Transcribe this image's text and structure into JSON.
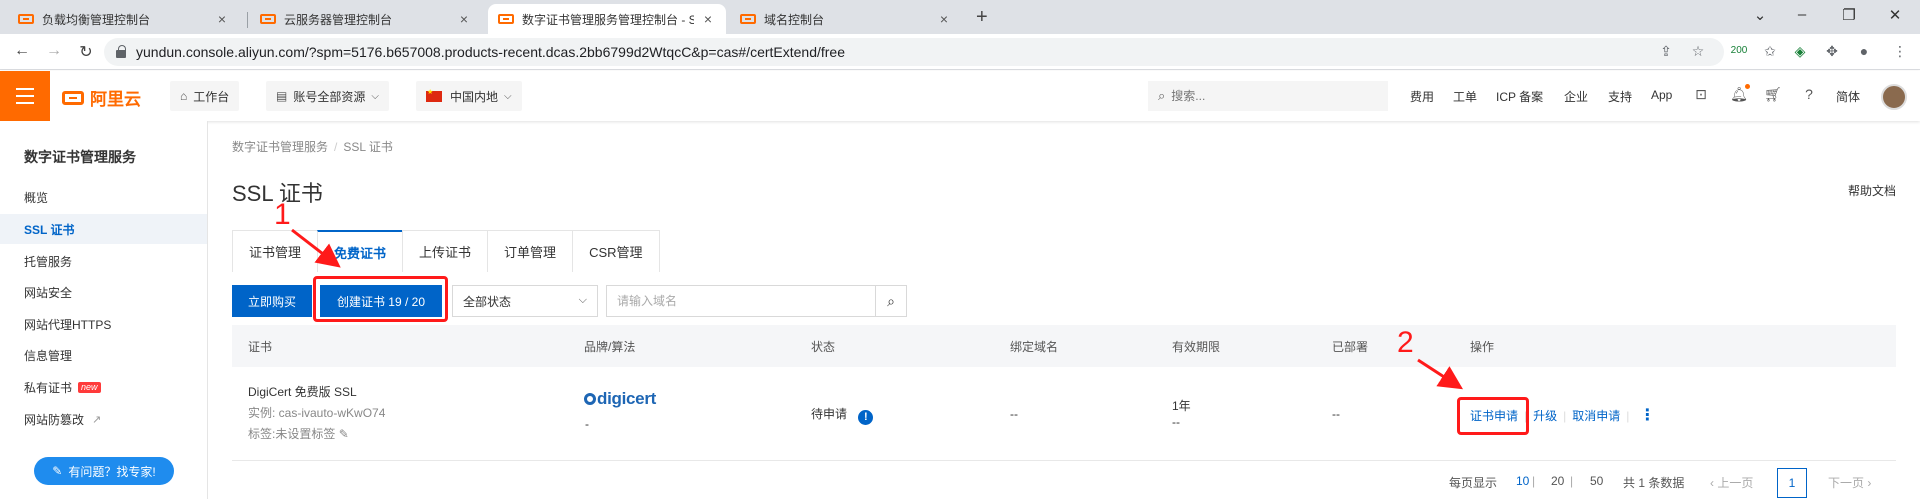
{
  "browser": {
    "tabs": [
      {
        "label": "负载均衡管理控制台",
        "close": "×"
      },
      {
        "label": "云服务器管理控制台",
        "close": "×"
      },
      {
        "label": "数字证书管理服务管理控制台 - S",
        "close": "×"
      },
      {
        "label": "域名控制台",
        "close": "×"
      }
    ],
    "active_tab": 2,
    "new_tab": "+",
    "url": "yundun.console.aliyun.com/?spm=5176.b657008.products-recent.dcas.2bb6799d2WtqcC&p=cas#/certExtend/free",
    "extension_count": "200"
  },
  "topbar": {
    "brand": "阿里云",
    "workbench": "工作台",
    "account_resources": "账号全部资源",
    "region": "中国内地",
    "search_placeholder": "搜索...",
    "links": [
      "费用",
      "工单",
      "ICP 备案",
      "企业",
      "支持",
      "App"
    ],
    "language": "简体"
  },
  "sidebar": {
    "title": "数字证书管理服务",
    "items": [
      {
        "label": "概览"
      },
      {
        "label": "SSL 证书"
      },
      {
        "label": "托管服务"
      },
      {
        "label": "网站安全"
      },
      {
        "label": "网站代理HTTPS"
      },
      {
        "label": "信息管理"
      },
      {
        "label": "私有证书"
      },
      {
        "label": "网站防篡改"
      }
    ],
    "active_index": 1,
    "new_badge": "new",
    "help_button": "有问题？找专家!"
  },
  "main": {
    "breadcrumb": [
      "数字证书管理服务",
      "SSL 证书"
    ],
    "title": "SSL 证书",
    "help_doc": "帮助文档",
    "tabs": [
      {
        "label": "证书管理"
      },
      {
        "label": "免费证书"
      },
      {
        "label": "上传证书"
      },
      {
        "label": "订单管理"
      },
      {
        "label": "CSR管理"
      }
    ],
    "active_tab": 1,
    "buy_button": "立即购买",
    "create_button": "创建证书 19 / 20",
    "status_select": "全部状态",
    "domain_placeholder": "请输入域名",
    "table": {
      "headers": [
        "证书",
        "品牌/算法",
        "状态",
        "绑定域名",
        "有效期限",
        "已部署",
        "操作"
      ],
      "row": {
        "cert_name": "DigiCert 免费版 SSL",
        "instance": "实例: cas-ivauto-wKwO74",
        "tags": "标签:未设置标签",
        "brand": "digicert",
        "brand_sub": "-",
        "status": "待申请",
        "domain": "--",
        "validity": "1年",
        "validity_sub": "--",
        "deployed": "--",
        "actions": [
          "证书申请",
          "升级",
          "取消申请"
        ]
      }
    },
    "pagination": {
      "per_page_label": "每页显示",
      "sizes": [
        "10",
        "20",
        "50"
      ],
      "total": "共 1 条数据",
      "prev": "上一页",
      "current": "1",
      "next": "下一页"
    }
  },
  "annotations": {
    "marker_1": "1",
    "marker_2": "2",
    "color": "#ff1a1a"
  }
}
